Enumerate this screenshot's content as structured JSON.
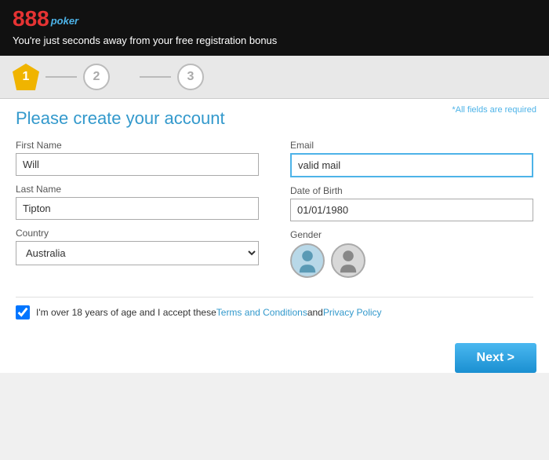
{
  "header": {
    "logo_888": "888",
    "logo_poker": "poker",
    "tagline": "You're just seconds away from your free registration bonus"
  },
  "steps": {
    "step1_label": "1",
    "step2_label": "2",
    "step3_label": "3"
  },
  "form": {
    "required_note": "*All fields are required",
    "title": "Please create your account",
    "first_name_label": "First Name",
    "first_name_value": "Will",
    "last_name_label": "Last Name",
    "last_name_value": "Tipton",
    "country_label": "Country",
    "country_value": "Australia",
    "email_label": "Email",
    "email_value": "valid mail",
    "email_placeholder": "valid mail",
    "dob_label": "Date of Birth",
    "dob_value": "01/01/1980",
    "gender_label": "Gender",
    "terms_text_before": "I'm over 18 years of age and I accept these ",
    "terms_link1": "Terms and Conditions",
    "terms_text_mid": " and ",
    "terms_link2": "Privacy Policy",
    "next_button": "Next >"
  }
}
